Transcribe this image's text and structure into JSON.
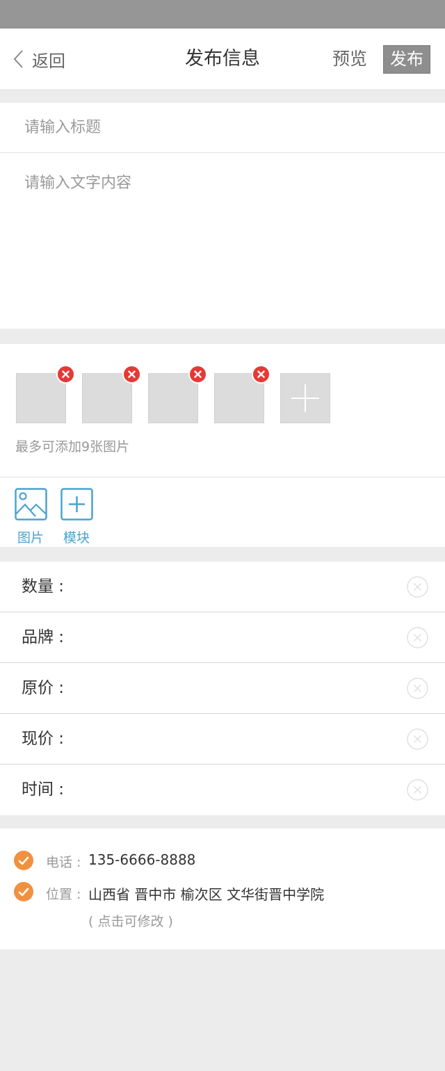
{
  "nav": {
    "back_label": "返回",
    "title": "发布信息",
    "preview_label": "预览",
    "publish_label": "发布"
  },
  "compose": {
    "title_placeholder": "请输入标题",
    "content_placeholder": "请输入文字内容"
  },
  "images": {
    "hint": "最多可添加9张图片"
  },
  "tools": {
    "picture_label": "图片",
    "module_label": "模块"
  },
  "fields": [
    {
      "label": "数量 :"
    },
    {
      "label": "品牌 :"
    },
    {
      "label": "原价 :"
    },
    {
      "label": "现价 :"
    },
    {
      "label": "时间 :"
    }
  ],
  "contact": {
    "phone_label": "电话 :",
    "phone_value": "135-6666-8888",
    "location_label": "位置 :",
    "location_value": "山西省 晋中市 榆次区 文华街晋中学院",
    "edit_hint": "( 点击可修改 )"
  },
  "colors": {
    "accent_blue": "#4aa3cf",
    "delete_red": "#e53935",
    "check_orange": "#f0913f",
    "publish_gray": "#8e8e8e"
  }
}
